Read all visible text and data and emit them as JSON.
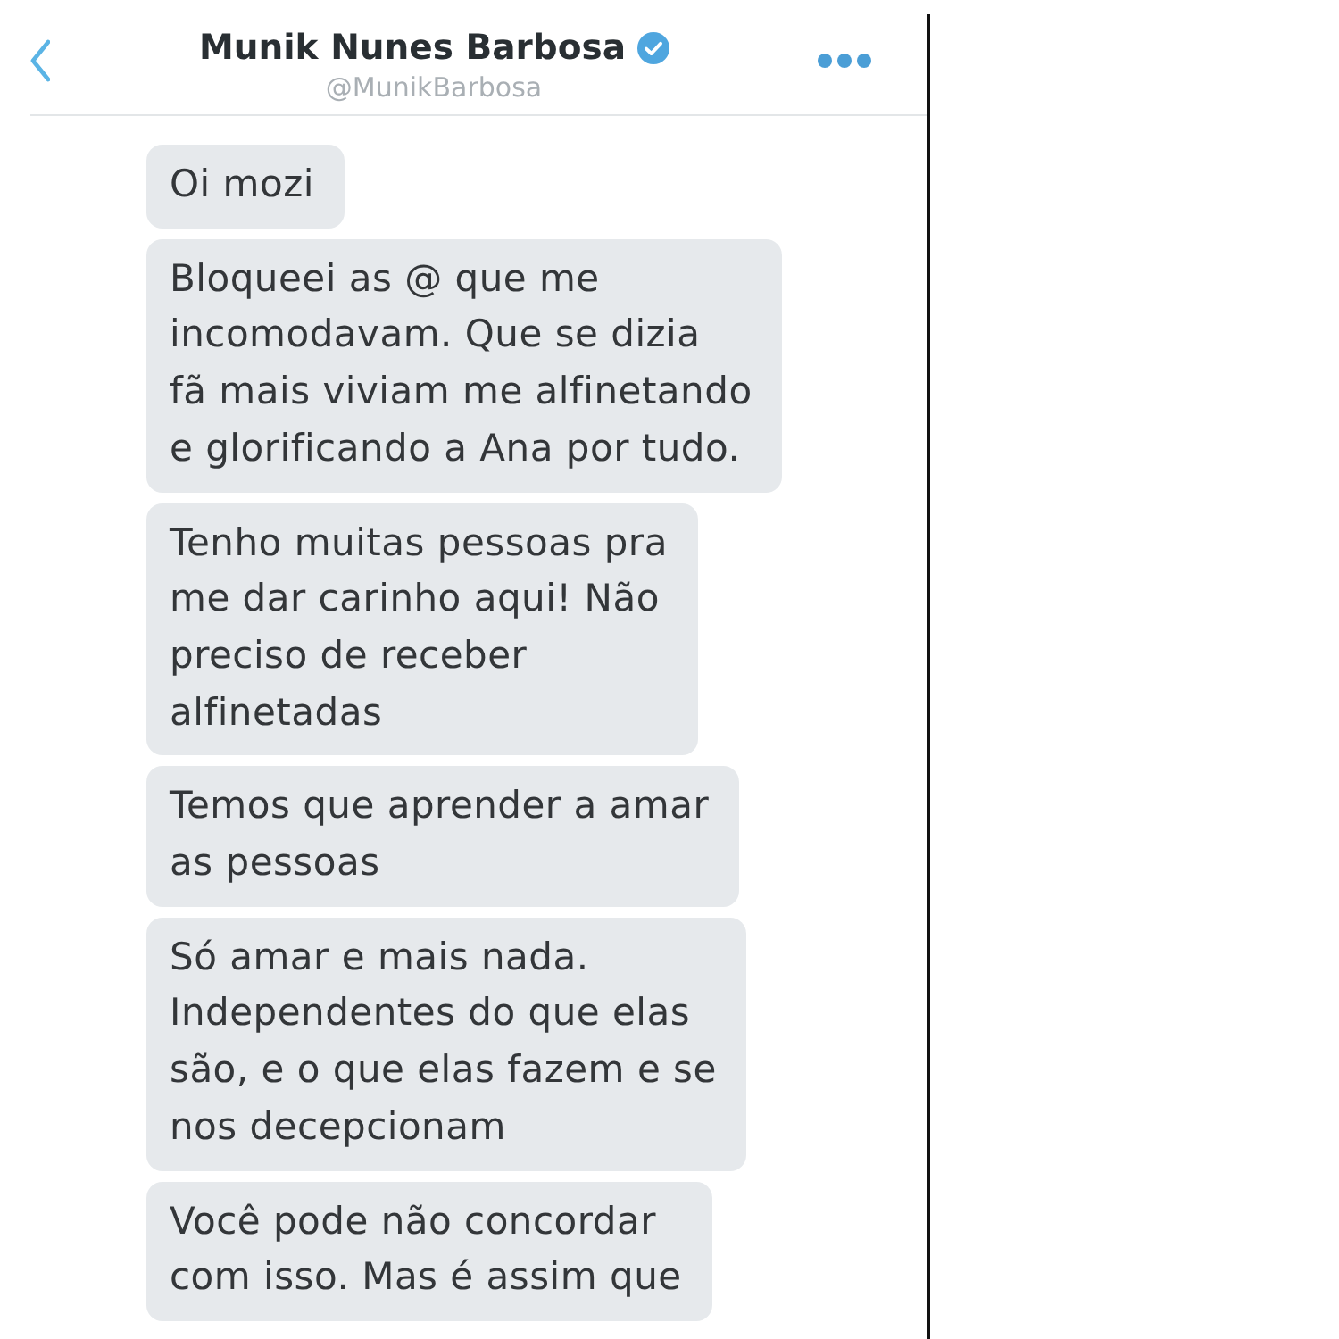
{
  "header": {
    "title": "Munik Nunes Barbosa",
    "verified": true,
    "handle": "@MunikBarbosa"
  },
  "messages": [
    {
      "text": "Oi mozi"
    },
    {
      "text": "Bloqueei as @ que me\nincomodavam. Que se dizia\nfã mais viviam me alfinetando\ne glorificando a Ana por tudo."
    },
    {
      "text": "Tenho muitas pessoas pra\nme dar carinho aqui! Não\npreciso de receber\nalfinetadas"
    },
    {
      "text": "Temos que aprender a amar\nas pessoas"
    },
    {
      "text": "Só amar e mais nada.\nIndependentes do que elas\nsão, e o que elas fazem e se\nnos decepcionam"
    },
    {
      "text": "Você pode não concordar\ncom isso. Mas é assim que"
    }
  ]
}
